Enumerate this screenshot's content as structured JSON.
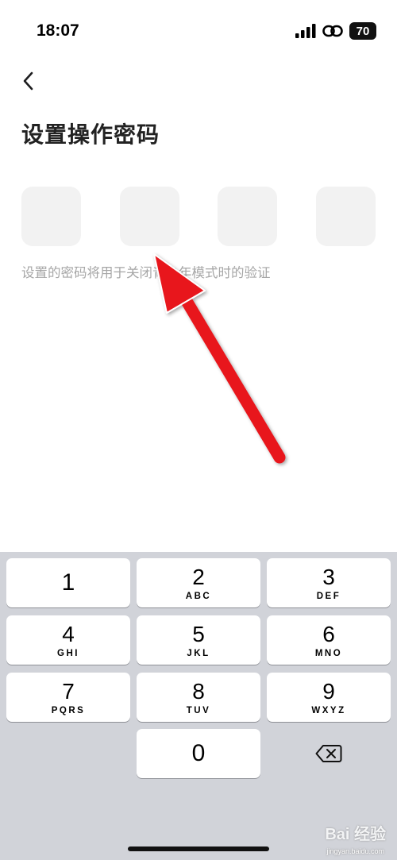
{
  "status_bar": {
    "time": "18:07",
    "battery": "70",
    "icons": [
      "signal-icon",
      "link-icon",
      "battery-icon"
    ]
  },
  "header": {
    "back_icon": "chevron-left-icon",
    "title": "设置操作密码"
  },
  "pin": {
    "box_count": 4,
    "hint": "设置的密码将用于关闭青少年模式时的验证"
  },
  "keypad": {
    "keys": [
      {
        "digit": "1",
        "letters": ""
      },
      {
        "digit": "2",
        "letters": "ABC"
      },
      {
        "digit": "3",
        "letters": "DEF"
      },
      {
        "digit": "4",
        "letters": "GHI"
      },
      {
        "digit": "5",
        "letters": "JKL"
      },
      {
        "digit": "6",
        "letters": "MNO"
      },
      {
        "digit": "7",
        "letters": "PQRS"
      },
      {
        "digit": "8",
        "letters": "TUV"
      },
      {
        "digit": "9",
        "letters": "WXYZ"
      },
      {
        "digit": "0",
        "letters": ""
      }
    ],
    "delete_icon": "backspace-icon"
  },
  "annotation": {
    "arrow_color": "#e8141c"
  },
  "watermark": {
    "text": "Bai 经验",
    "sub": "jingyan.baidu.com"
  },
  "colors": {
    "keypad_bg": "#d1d3d9",
    "pin_box": "#f2f2f2",
    "hint_text": "#a6a6a6"
  }
}
